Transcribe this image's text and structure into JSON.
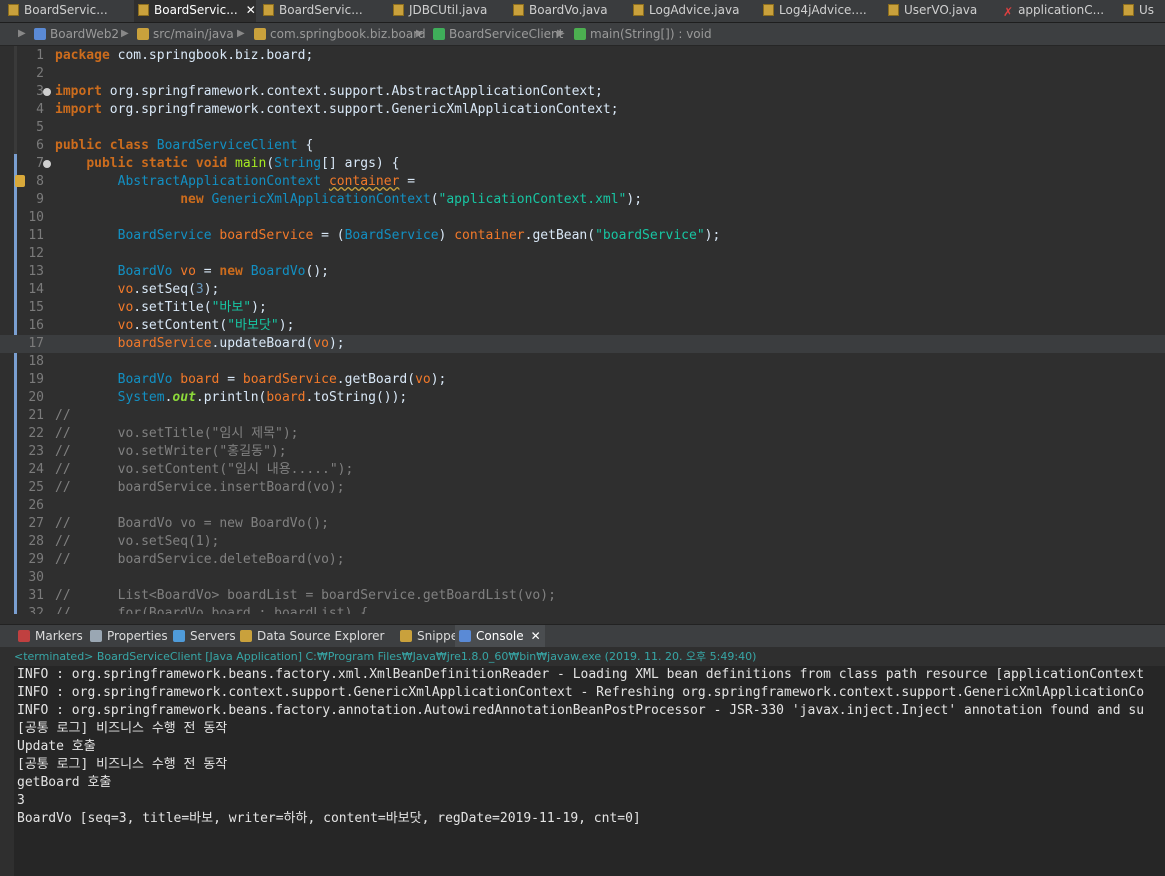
{
  "editor_tabs": [
    {
      "label": "BoardServic...",
      "icon": "java-file-icon",
      "active": false
    },
    {
      "label": "BoardServic...",
      "icon": "java-file-icon",
      "active": true,
      "close": "✕"
    },
    {
      "label": "BoardServic...",
      "icon": "java-file-icon",
      "active": false
    },
    {
      "label": "JDBCUtil.java",
      "icon": "java-file-icon",
      "active": false
    },
    {
      "label": "BoardVo.java",
      "icon": "java-file-icon",
      "active": false
    },
    {
      "label": "LogAdvice.java",
      "icon": "java-file-icon",
      "active": false
    },
    {
      "label": "Log4jAdvice....",
      "icon": "java-file-icon",
      "active": false
    },
    {
      "label": "UserVO.java",
      "icon": "java-file-icon",
      "active": false
    },
    {
      "label": "applicationC...",
      "icon": "xml-file-icon",
      "active": false
    },
    {
      "label": "Us",
      "icon": "java-file-icon",
      "active": false
    }
  ],
  "breadcrumb": [
    {
      "label": "BoardWeb2",
      "icon": "project-icon",
      "color": "#5a8ad6"
    },
    {
      "label": "src/main/java",
      "icon": "source-folder-icon",
      "color": "#c9a13c"
    },
    {
      "label": "com.springbook.biz.board",
      "icon": "package-icon",
      "color": "#c9a13c"
    },
    {
      "label": "BoardServiceClient",
      "icon": "class-icon",
      "color": "#3fae5a"
    },
    {
      "label": "main(String[]) : void",
      "icon": "method-icon",
      "color": "#4caf50"
    }
  ],
  "code_lines": [
    {
      "n": "1",
      "html": "<span class='kw'>package</span> com.springbook.biz.board;"
    },
    {
      "n": "2",
      "html": ""
    },
    {
      "n": "3",
      "html": "<span class='kw'>import</span> org.springframework.context.support.AbstractApplicationContext;",
      "fold": true
    },
    {
      "n": "4",
      "html": "<span class='kw'>import</span> org.springframework.context.support.GenericXmlApplicationContext;"
    },
    {
      "n": "5",
      "html": ""
    },
    {
      "n": "6",
      "html": "<span class='kw'>public class</span> <span class='ty'>BoardServiceClient</span> {"
    },
    {
      "n": "7",
      "html": "    <span class='kw'>public static void</span> <span class='mt'>main</span>(<span class='ty'>String</span>[] args) {",
      "fold": true
    },
    {
      "n": "8",
      "html": "        <span class='ty'>AbstractApplicationContext</span> <span class='sq' style='color:#f2792a'>container</span> =",
      "warn": true
    },
    {
      "n": "9",
      "html": "                <span class='kw'>new</span> <span class='ty'>GenericXmlApplicationContext</span>(<span class='st'>\"applicationContext.xml\"</span>);"
    },
    {
      "n": "10",
      "html": ""
    },
    {
      "n": "11",
      "html": "        <span class='ty'>BoardService</span> <span style='color:#f2792a'>boardService</span> = (<span class='ty'>BoardService</span>) <span style='color:#f2792a'>container</span>.getBean(<span class='st'>\"boardService\"</span>);"
    },
    {
      "n": "12",
      "html": ""
    },
    {
      "n": "13",
      "html": "        <span class='ty'>BoardVo</span> <span style='color:#f2792a'>vo</span> = <span class='kw'>new</span> <span class='ty'>BoardVo</span>();"
    },
    {
      "n": "14",
      "html": "        <span style='color:#f2792a'>vo</span>.setSeq(<span style='color:#6897bb'>3</span>);"
    },
    {
      "n": "15",
      "html": "        <span style='color:#f2792a'>vo</span>.setTitle(<span class='st'>\"바보\"</span>);"
    },
    {
      "n": "16",
      "html": "        <span style='color:#f2792a'>vo</span>.setContent(<span class='st'>\"바보닷\"</span>);"
    },
    {
      "n": "17",
      "html": "        <span style='color:#f2792a'>boardService</span>.updateBoard(<span style='color:#f2792a'>vo</span>);",
      "current": true
    },
    {
      "n": "18",
      "html": ""
    },
    {
      "n": "19",
      "html": "        <span class='ty'>BoardVo</span> <span style='color:#f2792a'>board</span> = <span style='color:#f2792a'>boardService</span>.getBoard(<span style='color:#f2792a'>vo</span>);"
    },
    {
      "n": "20",
      "html": "        <span class='ty'>System</span>.<i class='fld'><b>out</b></i>.println(<span style='color:#f2792a'>board</span>.toString());"
    },
    {
      "n": "21",
      "html": "<span class='cm'>//</span>"
    },
    {
      "n": "22",
      "html": "<span class='cm'>//      vo.setTitle(\"임시 제목\");</span>"
    },
    {
      "n": "23",
      "html": "<span class='cm'>//      vo.setWriter(\"홍길동\");</span>"
    },
    {
      "n": "24",
      "html": "<span class='cm'>//      vo.setContent(\"임시 내용.....\");</span>"
    },
    {
      "n": "25",
      "html": "<span class='cm'>//      boardService.insertBoard(vo);</span>"
    },
    {
      "n": "26",
      "html": ""
    },
    {
      "n": "27",
      "html": "<span class='cm'>//      BoardVo vo = new BoardVo();</span>"
    },
    {
      "n": "28",
      "html": "<span class='cm'>//      vo.setSeq(1);</span>"
    },
    {
      "n": "29",
      "html": "<span class='cm'>//      boardService.deleteBoard(vo);</span>"
    },
    {
      "n": "30",
      "html": ""
    },
    {
      "n": "31",
      "html": "<span class='cm'>//      List&lt;BoardVo&gt; boardList = boardService.getBoardList(vo);</span>"
    },
    {
      "n": "32",
      "html": "<span class='cm'>//      for(BoardVo board : boardList) {</span>"
    }
  ],
  "view_tabs": [
    {
      "label": "Markers",
      "icon": "markers-icon",
      "color": "#c04040",
      "active": false
    },
    {
      "label": "Properties",
      "icon": "properties-icon",
      "color": "#9aa7b3",
      "active": false
    },
    {
      "label": "Servers",
      "icon": "servers-icon",
      "color": "#4f9bd9",
      "active": false
    },
    {
      "label": "Data Source Explorer",
      "icon": "data-source-icon",
      "color": "#c9a13c",
      "active": false
    },
    {
      "label": "Snippets",
      "icon": "snippets-icon",
      "color": "#c9a13c",
      "active": false
    },
    {
      "label": "Console",
      "icon": "console-icon",
      "color": "#5a8ad6",
      "active": true,
      "close": "✕"
    }
  ],
  "console": {
    "status": "<terminated> BoardServiceClient [Java Application] C:₩Program Files₩Java₩jre1.8.0_60₩bin₩javaw.exe (2019. 11. 20. 오후 5:49:40)",
    "lines": [
      "INFO : org.springframework.beans.factory.xml.XmlBeanDefinitionReader - Loading XML bean definitions from class path resource [applicationContext",
      "INFO : org.springframework.context.support.GenericXmlApplicationContext - Refreshing org.springframework.context.support.GenericXmlApplicationCo",
      "INFO : org.springframework.beans.factory.annotation.AutowiredAnnotationBeanPostProcessor - JSR-330 'javax.inject.Inject' annotation found and su",
      "[공통 로그] 비즈니스 수행 전 동작",
      "Update 호출",
      "[공통 로그] 비즈니스 수행 전 동작",
      "getBoard 호출",
      "3",
      "BoardVo [seq=3, title=바보, writer=하하, content=바보닷, regDate=2019-11-19, cnt=0]"
    ]
  }
}
